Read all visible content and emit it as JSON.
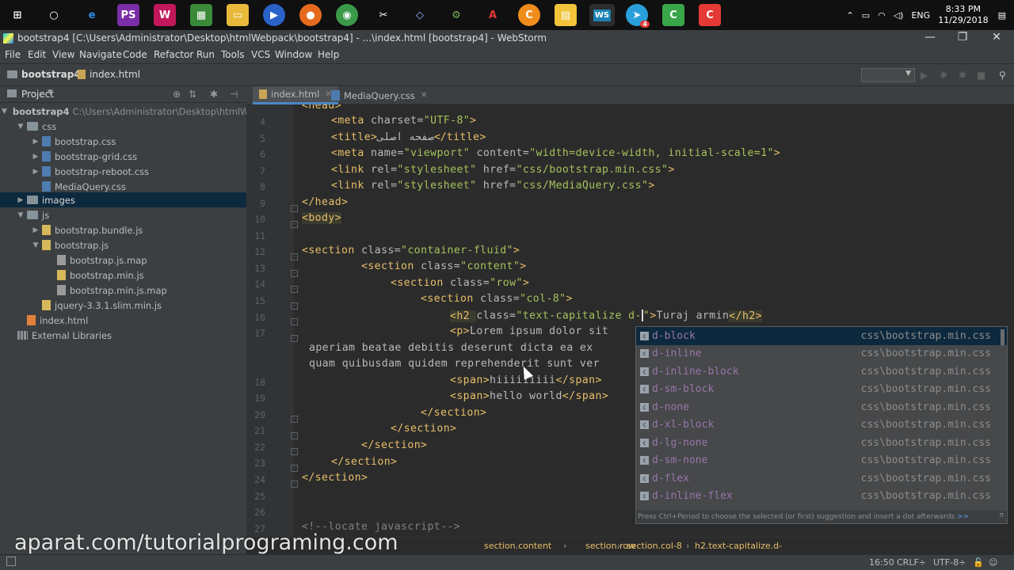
{
  "taskbar": {
    "icons": [
      "windows-start",
      "cortana",
      "edge",
      "photoshop",
      "webstorm-alt",
      "store",
      "explorer",
      "media",
      "firefox",
      "chrome",
      "tool",
      "3d",
      "tool2",
      "acrobat",
      "c-app",
      "folder-app",
      "webstorm",
      "telegram",
      "camtasia",
      "c-red"
    ],
    "telegram_badge": "4",
    "lang": "ENG",
    "time": "8:33 PM",
    "date": "11/29/2018"
  },
  "window": {
    "title": "bootstrap4 [C:\\Users\\Administrator\\Desktop\\htmlWebpack\\bootstrap4] - ...\\index.html [bootstrap4] - WebStorm",
    "minimize": "—",
    "restore": "❐",
    "close": "✕"
  },
  "menu": [
    "File",
    "Edit",
    "View",
    "Navigate",
    "Code",
    "Refactor",
    "Run",
    "Tools",
    "VCS",
    "Window",
    "Help"
  ],
  "navbar": {
    "project": "bootstrap4",
    "file": "index.html"
  },
  "project_panel": {
    "title": "Project",
    "root_name": "bootstrap4",
    "root_path": "C:\\Users\\Administrator\\Desktop\\htmlWeb",
    "items": [
      {
        "label": "css"
      },
      {
        "label": "bootstrap.css"
      },
      {
        "label": "bootstrap-grid.css"
      },
      {
        "label": "bootstrap-reboot.css"
      },
      {
        "label": "MediaQuery.css"
      },
      {
        "label": "images"
      },
      {
        "label": "js"
      },
      {
        "label": "bootstrap.bundle.js"
      },
      {
        "label": "bootstrap.js"
      },
      {
        "label": "bootstrap.js.map"
      },
      {
        "label": "bootstrap.min.js"
      },
      {
        "label": "bootstrap.min.js.map"
      },
      {
        "label": "jquery-3.3.1.slim.min.js"
      },
      {
        "label": "index.html"
      },
      {
        "label": "External Libraries"
      }
    ]
  },
  "tabs": [
    {
      "label": "index.html"
    },
    {
      "label": "MediaQuery.css"
    }
  ],
  "editor": {
    "line_numbers": [
      "4",
      "5",
      "6",
      "7",
      "8",
      "9",
      "10",
      "11",
      "12",
      "13",
      "14",
      "15",
      "16",
      "17",
      "",
      "",
      "18",
      "19",
      "20",
      "21",
      "22",
      "23",
      "24",
      "25",
      "26",
      "27"
    ],
    "lines": {
      "l3": "<head>",
      "l4_tag": "<meta ",
      "l4_attr": "charset=",
      "l4_val": "\"UTF-8\"",
      "l4_end": ">",
      "l5_open": "<title>",
      "l5_text": "صفحه اصلی",
      "l5_close": "</title>",
      "l6_tag": "<meta ",
      "l6_a1": "name=",
      "l6_v1": "\"viewport\"",
      "l6_a2": " content=",
      "l6_v2": "\"width=device-width, initial-scale=1\"",
      "l6_end": ">",
      "l7_tag": "<link ",
      "l7_a1": "rel=",
      "l7_v1": "\"stylesheet\"",
      "l7_a2": " href=",
      "l7_v2": "\"css/bootstrap.min.css\"",
      "l7_end": ">",
      "l8_tag": "<link ",
      "l8_a1": "rel=",
      "l8_v1": "\"stylesheet\"",
      "l8_a2": " href=",
      "l8_v2": "\"css/MediaQuery.css\"",
      "l8_end": ">",
      "l9": "</head>",
      "l10": "<body>",
      "l12_tag": "<section ",
      "l12_a": "class=",
      "l12_v": "\"container-fluid\"",
      "l12_end": ">",
      "l13_tag": "<section ",
      "l13_a": "class=",
      "l13_v": "\"content\"",
      "l13_end": ">",
      "l14_tag": "<section ",
      "l14_a": "class=",
      "l14_v": "\"row\"",
      "l14_end": ">",
      "l15_tag": "<section ",
      "l15_a": "class=",
      "l15_v": "\"col-8\"",
      "l15_end": ">",
      "l16_tag": "<h2 ",
      "l16_a": "class=",
      "l16_v": "\"text-capitalize d-",
      "l16_v2": "\"",
      "l16_end": ">",
      "l16_text": "Turaj armin",
      "l16_close": "</h2>",
      "l17_tag": "<p>",
      "l17_text": "Lorem ipsum dolor sit",
      "l17b": "aperiam beatae debitis deserunt dicta ea ex",
      "l17c": "quam quibusdam quidem reprehenderit sunt ver",
      "l18_open": "<span>",
      "l18_text": "hiiiiiiiii",
      "l18_close": "</span>",
      "l19_open": "<span>",
      "l19_text": "hello world",
      "l19_close": "</span>",
      "l20": "</section>",
      "l21": "</section>",
      "l22": "</section>",
      "l23": "</section>",
      "l24": "</section>",
      "l26": "<!--locate javascript-->"
    }
  },
  "autocomplete": {
    "items": [
      {
        "name": "d-block",
        "source": "css\\bootstrap.min.css"
      },
      {
        "name": "d-inline",
        "source": "css\\bootstrap.min.css"
      },
      {
        "name": "d-inline-block",
        "source": "css\\bootstrap.min.css"
      },
      {
        "name": "d-sm-block",
        "source": "css\\bootstrap.min.css"
      },
      {
        "name": "d-none",
        "source": "css\\bootstrap.min.css"
      },
      {
        "name": "d-xl-block",
        "source": "css\\bootstrap.min.css"
      },
      {
        "name": "d-lg-none",
        "source": "css\\bootstrap.min.css"
      },
      {
        "name": "d-sm-none",
        "source": "css\\bootstrap.min.css"
      },
      {
        "name": "d-flex",
        "source": "css\\bootstrap.min.css"
      },
      {
        "name": "d-inline-flex",
        "source": "css\\bootstrap.min.css"
      }
    ],
    "hint": "Press Ctrl+Period to choose the selected (or first) suggestion and insert a dot afterwards",
    "hint_link": ">>"
  },
  "breadcrumbs": [
    "section.content",
    "section.row",
    "section.col-8",
    "h2.text-capitalize.d-"
  ],
  "status": {
    "position": "16:50",
    "line_sep": "CRLF÷",
    "encoding": "UTF-8÷"
  },
  "watermark": "aparat.com/tutorialprograming.com",
  "colors": {
    "tag": "#e8bf6a",
    "attr_value": "#a5c25c",
    "class_name": "#9876aa",
    "selection": "#0d293e"
  }
}
